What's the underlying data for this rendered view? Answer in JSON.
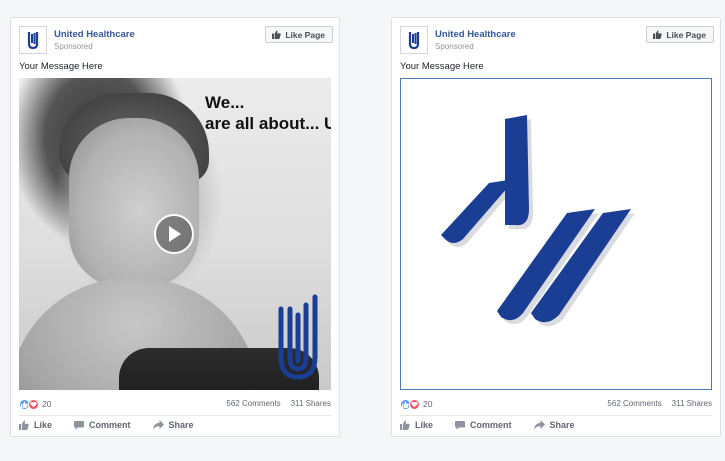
{
  "colors": {
    "brand_blue": "#1b3e95",
    "link_blue": "#365899",
    "meta_gray": "#90949c",
    "like_blue": "#5890ff",
    "love_red": "#f25268"
  },
  "posts": [
    {
      "page_name": "United Healthcare",
      "sponsored": "Sponsored",
      "like_page_label": "Like Page",
      "message": "Your Message Here",
      "headline_line1": "We...",
      "headline_line2": "are all about... U.",
      "reaction_count": "20",
      "comments": "562 Comments",
      "shares": "311 Shares",
      "actions": {
        "like": "Like",
        "comment": "Comment",
        "share": "Share"
      }
    },
    {
      "page_name": "United Healthcare",
      "sponsored": "Sponsored",
      "like_page_label": "Like Page",
      "message": "Your Message Here",
      "reaction_count": "20",
      "comments": "562 Comments",
      "shares": "311 Shares",
      "actions": {
        "like": "Like",
        "comment": "Comment",
        "share": "Share"
      }
    }
  ],
  "icons": {
    "avatar": "uhc-logo-icon",
    "thumbs_up": "thumbs-up-icon",
    "comment": "comment-icon",
    "share": "share-icon",
    "play": "play-icon",
    "love": "heart-icon"
  }
}
